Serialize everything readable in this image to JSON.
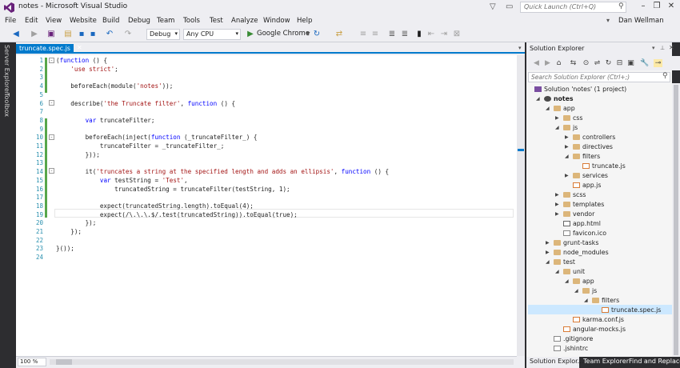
{
  "window": {
    "title": "notes - Microsoft Visual Studio",
    "quick_launch_placeholder": "Quick Launch (Ctrl+Q)",
    "user": "Dan Wellman"
  },
  "menu": [
    "File",
    "Edit",
    "View",
    "Website",
    "Build",
    "Debug",
    "Team",
    "Tools",
    "Test",
    "Analyze",
    "Window",
    "Help"
  ],
  "toolbar": {
    "configuration": "Debug",
    "platform": "Any CPU",
    "run_target": "Google Chrome"
  },
  "side_tabs": [
    "Server Explorer",
    "Toolbox"
  ],
  "editor": {
    "tab": "truncate.spec.js",
    "zoom": "100 %",
    "line_numbers": [
      "1",
      "2",
      "3",
      "4",
      "5",
      "6",
      "7",
      "8",
      "9",
      "10",
      "11",
      "12",
      "13",
      "14",
      "15",
      "16",
      "17",
      "18",
      "19",
      "20",
      "21",
      "22",
      "23",
      "24"
    ],
    "lines": [
      "(function () {",
      "    'use strict';",
      "",
      "    beforeEach(module('notes'));",
      "",
      "    describe('the Truncate filter', function () {",
      "",
      "        var truncateFilter;",
      "",
      "        beforeEach(inject(function (_truncateFilter_) {",
      "            truncateFilter = _truncateFilter_;",
      "        }));",
      "",
      "        it('truncates a string at the specified length and adds an ellipsis', function () {",
      "            var testString = 'Test',",
      "                truncatedString = truncateFilter(testString, 1);",
      "",
      "            expect(truncatedString.length).toEqual(4);",
      "            expect(/\\.\\.\\.$/.test(truncatedString)).toEqual(true);",
      "        });",
      "    });",
      "",
      "}());",
      ""
    ]
  },
  "solution_explorer": {
    "title": "Solution Explorer",
    "search_placeholder": "Search Solution Explorer (Ctrl+;)",
    "tree": [
      {
        "label": "Solution 'notes' (1 project)",
        "type": "sln"
      },
      {
        "label": "notes",
        "type": "proj"
      },
      {
        "label": "app",
        "type": "folder"
      },
      {
        "label": "css",
        "type": "folder"
      },
      {
        "label": "js",
        "type": "folder"
      },
      {
        "label": "controllers",
        "type": "folder"
      },
      {
        "label": "directives",
        "type": "folder"
      },
      {
        "label": "filters",
        "type": "folder"
      },
      {
        "label": "truncate.js",
        "type": "js"
      },
      {
        "label": "services",
        "type": "folder"
      },
      {
        "label": "app.js",
        "type": "js"
      },
      {
        "label": "scss",
        "type": "folder"
      },
      {
        "label": "templates",
        "type": "folder"
      },
      {
        "label": "vendor",
        "type": "folder"
      },
      {
        "label": "app.html",
        "type": "html"
      },
      {
        "label": "favicon.ico",
        "type": "gen"
      },
      {
        "label": "grunt-tasks",
        "type": "folder"
      },
      {
        "label": "node_modules",
        "type": "folder"
      },
      {
        "label": "test",
        "type": "folder"
      },
      {
        "label": "unit",
        "type": "folder"
      },
      {
        "label": "app",
        "type": "folder"
      },
      {
        "label": "js",
        "type": "folder"
      },
      {
        "label": "filters",
        "type": "folder"
      },
      {
        "label": "truncate.spec.js",
        "type": "js"
      },
      {
        "label": "karma.conf.js",
        "type": "js"
      },
      {
        "label": "angular-mocks.js",
        "type": "js"
      },
      {
        "label": ".gitignore",
        "type": "gen"
      },
      {
        "label": ".jshintrc",
        "type": "gen"
      }
    ],
    "bottom_tabs": [
      "Solution Explor...",
      "Team Explorer",
      "Find and Replace"
    ]
  }
}
